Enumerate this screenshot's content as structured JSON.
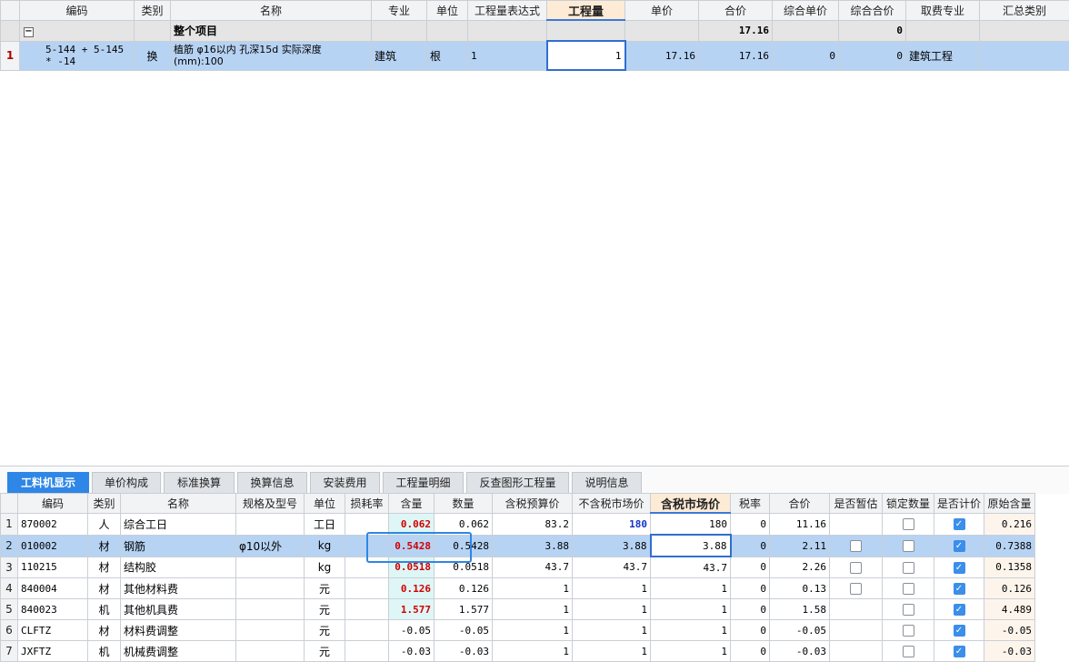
{
  "top_grid": {
    "headers": [
      "编码",
      "类别",
      "名称",
      "专业",
      "单位",
      "工程量表达式",
      "工程量",
      "单价",
      "合价",
      "综合单价",
      "综合合价",
      "取费专业",
      "汇总类别"
    ],
    "group_row": {
      "expander": "−",
      "name": "整个项目",
      "total_price": "17.16",
      "comp_total": "0"
    },
    "rows": [
      {
        "index": "1",
        "code": "5-144 + 5-145 * -14",
        "type": "换",
        "name": "植筋 φ16以内 孔深15d  实际深度(mm):100",
        "major": "建筑",
        "unit": "根",
        "expr": "1",
        "qty": "1",
        "unit_price": "17.16",
        "total": "17.16",
        "comp_unit": "0",
        "comp_total": "0",
        "fee_major": "建筑工程",
        "summary": ""
      }
    ]
  },
  "tabs": [
    "工料机显示",
    "单价构成",
    "标准换算",
    "换算信息",
    "安装费用",
    "工程量明细",
    "反查图形工程量",
    "说明信息"
  ],
  "bottom_grid": {
    "headers": [
      "编码",
      "类别",
      "名称",
      "规格及型号",
      "单位",
      "损耗率",
      "含量",
      "数量",
      "含税预算价",
      "不含税市场价",
      "含税市场价",
      "税率",
      "合价",
      "是否暂估",
      "锁定数量",
      "是否计价",
      "原始含量"
    ],
    "rows": [
      {
        "n": "1",
        "code": "870002",
        "type": "人",
        "name": "综合工日",
        "spec": "",
        "unit": "工日",
        "loss": "",
        "content": "0.062",
        "qty": "0.062",
        "tax_budget": "83.2",
        "market_notax": "180",
        "market_tax": "180",
        "rate": "0",
        "total": "11.16",
        "est": "none",
        "lock": false,
        "priced": true,
        "orig": "0.216"
      },
      {
        "n": "2",
        "code": "010002",
        "type": "材",
        "name": "钢筋",
        "spec": "φ10以外",
        "unit": "kg",
        "loss": "",
        "content": "0.5428",
        "qty": "0.5428",
        "tax_budget": "3.88",
        "market_notax": "3.88",
        "market_tax": "3.88",
        "rate": "0",
        "total": "2.11",
        "est": "box",
        "lock": false,
        "priced": true,
        "orig": "0.7388"
      },
      {
        "n": "3",
        "code": "110215",
        "type": "材",
        "name": "结构胶",
        "spec": "",
        "unit": "kg",
        "loss": "",
        "content": "0.0518",
        "qty": "0.0518",
        "tax_budget": "43.7",
        "market_notax": "43.7",
        "market_tax": "43.7",
        "rate": "0",
        "total": "2.26",
        "est": "box",
        "lock": false,
        "priced": true,
        "orig": "0.1358"
      },
      {
        "n": "4",
        "code": "840004",
        "type": "材",
        "name": "其他材料费",
        "spec": "",
        "unit": "元",
        "loss": "",
        "content": "0.126",
        "qty": "0.126",
        "tax_budget": "1",
        "market_notax": "1",
        "market_tax": "1",
        "rate": "0",
        "total": "0.13",
        "est": "box",
        "lock": false,
        "priced": true,
        "orig": "0.126"
      },
      {
        "n": "5",
        "code": "840023",
        "type": "机",
        "name": "其他机具费",
        "spec": "",
        "unit": "元",
        "loss": "",
        "content": "1.577",
        "qty": "1.577",
        "tax_budget": "1",
        "market_notax": "1",
        "market_tax": "1",
        "rate": "0",
        "total": "1.58",
        "est": "none",
        "lock": false,
        "priced": true,
        "orig": "4.489"
      },
      {
        "n": "6",
        "code": "CLFTZ",
        "type": "材",
        "name": "材料费调整",
        "spec": "",
        "unit": "元",
        "loss": "",
        "content": "-0.05",
        "qty": "-0.05",
        "tax_budget": "1",
        "market_notax": "1",
        "market_tax": "1",
        "rate": "0",
        "total": "-0.05",
        "est": "none",
        "lock": false,
        "priced": true,
        "orig": "-0.05"
      },
      {
        "n": "7",
        "code": "JXFTZ",
        "type": "机",
        "name": "机械费调整",
        "spec": "",
        "unit": "元",
        "loss": "",
        "content": "-0.03",
        "qty": "-0.03",
        "tax_budget": "1",
        "market_notax": "1",
        "market_tax": "1",
        "rate": "0",
        "total": "-0.03",
        "est": "none",
        "lock": false,
        "priced": true,
        "orig": "-0.03"
      }
    ]
  }
}
